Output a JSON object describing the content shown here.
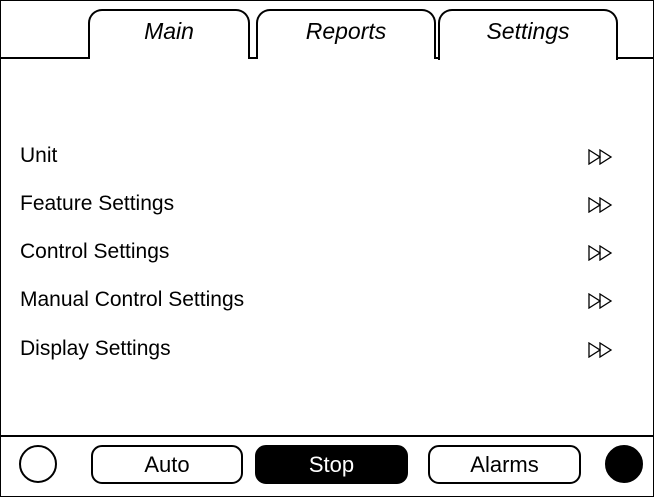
{
  "tabs": [
    {
      "label": "Main",
      "active": false
    },
    {
      "label": "Reports",
      "active": false
    },
    {
      "label": "Settings",
      "active": true
    }
  ],
  "menu": {
    "items": [
      {
        "label": "Unit",
        "arrow": "double-right-arrow-icon"
      },
      {
        "label": "Feature Settings",
        "arrow": "double-right-arrow-icon"
      },
      {
        "label": "Control Settings",
        "arrow": "double-right-arrow-icon"
      },
      {
        "label": "Manual Control Settings",
        "arrow": "double-right-arrow-icon"
      },
      {
        "label": "Display Settings",
        "arrow": "double-right-arrow-icon"
      }
    ]
  },
  "bottom_bar": {
    "auto_label": "Auto",
    "stop_label": "Stop",
    "alarms_label": "Alarms",
    "left_indicator": "off",
    "right_indicator": "on"
  },
  "colors": {
    "foreground": "#000000",
    "background": "#ffffff"
  }
}
